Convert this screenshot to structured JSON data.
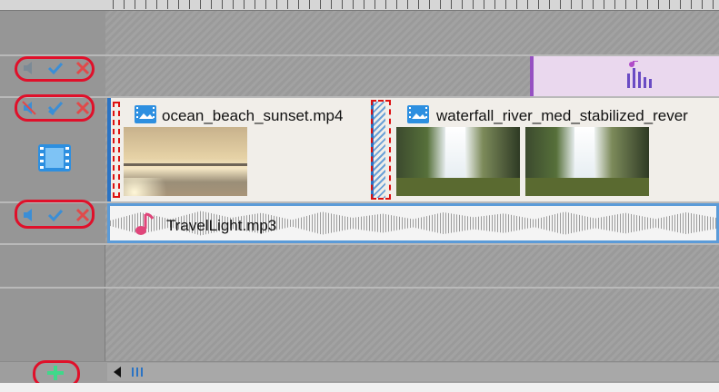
{
  "tracks": {
    "music_track": {
      "controls": [
        "speaker-muted-icon",
        "check-icon",
        "close-icon"
      ]
    },
    "video_track": {
      "controls": [
        "speaker-muted-icon",
        "check-icon",
        "close-icon"
      ],
      "clips": [
        {
          "name": "ocean_beach_sunset.mp4"
        },
        {
          "name": "waterfall_river_med_stabilized_rever"
        }
      ]
    },
    "audio_track": {
      "controls": [
        "speaker-icon",
        "check-icon",
        "close-icon"
      ],
      "clips": [
        {
          "name": "TravelLight.mp3"
        }
      ]
    }
  },
  "colors": {
    "highlight_oval": "#e0102a",
    "video_clip_border": "#2a73c4",
    "audio_clip_border": "#5b9bd8",
    "music_clip_bg": "#ead8ee",
    "music_clip_border": "#9650c2",
    "add_button": "#3fd88a"
  },
  "icons": {
    "add_track": "plus-icon",
    "scroll_left": "triangle-left-icon",
    "scroll_thumb": "grip-icon",
    "video_track_type": "film-icon",
    "music_clip": "equalizer-icon",
    "audio_clip": "music-note-icon",
    "video_clip": "video-file-icon"
  }
}
